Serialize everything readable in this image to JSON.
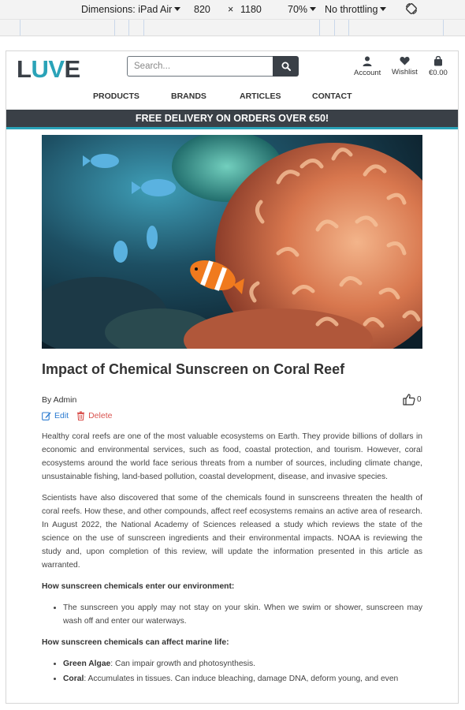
{
  "devtools": {
    "dimensions_label": "Dimensions: iPad Air",
    "width": "820",
    "times": "×",
    "height": "1180",
    "zoom": "70%",
    "throttling": "No throttling"
  },
  "header": {
    "logo_part1": "L",
    "logo_part2": "UV",
    "logo_part3": "E",
    "search_placeholder": "Search...",
    "account_label": "Account",
    "wishlist_label": "Wishlist",
    "cart_label": "€0.00"
  },
  "nav": {
    "items": [
      "PRODUCTS",
      "BRANDS",
      "ARTICLES",
      "CONTACT"
    ]
  },
  "promo": {
    "text": "FREE DELIVERY ON ORDERS OVER €50!"
  },
  "article": {
    "title": "Impact of Chemical Sunscreen on Coral Reef",
    "author": "By Admin",
    "like_count": "0",
    "edit_label": "Edit",
    "delete_label": "Delete",
    "paragraph1": "Healthy coral reefs are one of the most valuable ecosystems on Earth. They provide billions of dollars in economic and environmental services, such as food, coastal protection, and tourism. However, coral ecosystems around the world face serious threats from a number of sources, including climate change, unsustainable fishing, land-based pollution, coastal development, disease, and invasive species.",
    "paragraph2": "Scientists have also discovered that some of the chemicals found in sunscreens threaten the health of coral reefs. How these, and other compounds, affect reef ecosystems remains an active area of research. In August 2022, the National Academy of Sciences released a study which reviews the state of the science on the use of sunscreen ingredients and their environmental impacts. NOAA is reviewing the study and, upon completion of this review, will update the information presented in this article as warranted.",
    "subhead1": "How sunscreen chemicals enter our environment:",
    "bullet1": "The sunscreen you apply may not stay on your skin. When we swim or shower, sunscreen may wash off and enter our waterways.",
    "subhead2": "How sunscreen chemicals can affect marine life:",
    "bullet2_term": "Green Algae",
    "bullet2_text": ": Can impair growth and photosynthesis.",
    "bullet3_term": "Coral",
    "bullet3_text": ": Accumulates in tissues. Can induce bleaching, damage DNA, deform young, and even"
  },
  "colors": {
    "brand_dark": "#3a4047",
    "brand_accent": "#2aa3b8",
    "edit_blue": "#2b7bd0",
    "delete_red": "#d9534f"
  }
}
